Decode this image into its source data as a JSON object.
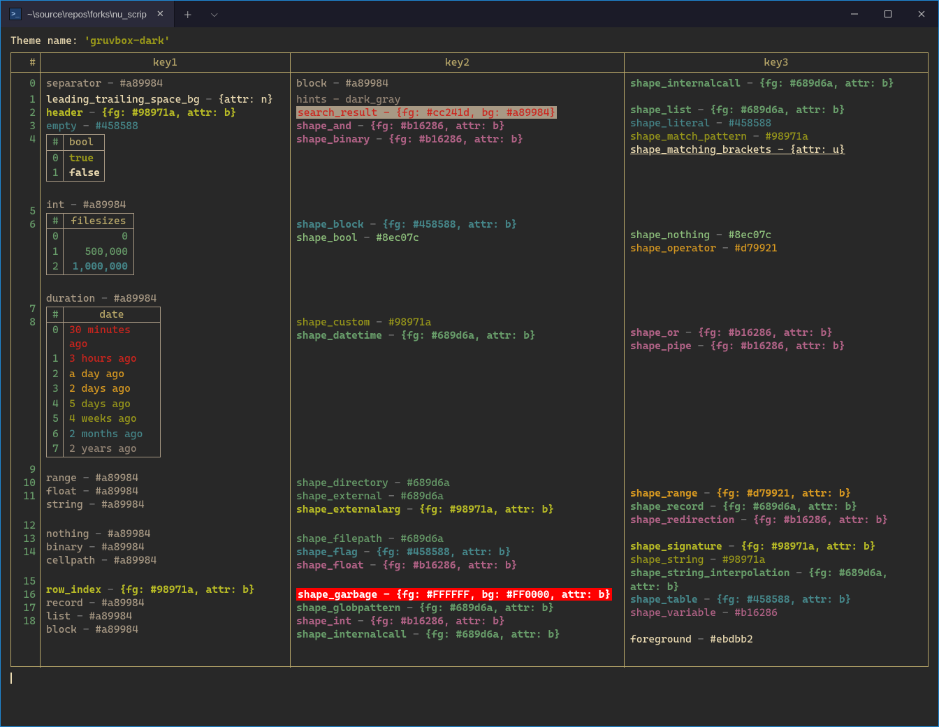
{
  "titlebar": {
    "tab_title": "~\\source\\repos\\forks\\nu_scrip",
    "tab_close": "✕",
    "newtab": "＋",
    "dropdown": "⌵"
  },
  "theme_label": "Theme name:",
  "theme_value": "'gruvbox-dark'",
  "columns": {
    "idx": "#",
    "k1": "key1",
    "k2": "key2",
    "k3": "key3"
  },
  "row_nums": [
    "0",
    "1",
    "2",
    "3",
    "4",
    "5",
    "6",
    "7",
    "8",
    "9",
    "10",
    "11",
    "12",
    "13",
    "14",
    "15",
    "16",
    "17",
    "18"
  ],
  "k1": {
    "separator": {
      "key": "separator",
      "sep": " - ",
      "val": "#a89984"
    },
    "leading": {
      "key": "leading_trailing_space_bg",
      "sep": " - ",
      "val": "{attr: n}"
    },
    "header": {
      "key": "header",
      "sep": " - ",
      "val": "{fg: #98971a, attr: b}"
    },
    "empty": {
      "key": "empty",
      "sep": " - ",
      "val": "#458588"
    },
    "int": {
      "key": "int",
      "sep": " - ",
      "val": "#a89984"
    },
    "duration": {
      "key": "duration",
      "sep": " - ",
      "val": "#a89984"
    },
    "range": {
      "key": "range",
      "sep": " - ",
      "val": "#a89984"
    },
    "float": {
      "key": "float",
      "sep": " - ",
      "val": "#a89984"
    },
    "string": {
      "key": "string",
      "sep": " - ",
      "val": "#a89984"
    },
    "nothing": {
      "key": "nothing",
      "sep": " - ",
      "val": "#a89984"
    },
    "binary": {
      "key": "binary",
      "sep": " - ",
      "val": "#a89984"
    },
    "cellpath": {
      "key": "cellpath",
      "sep": " - ",
      "val": "#a89984"
    },
    "row_index": {
      "key": "row_index",
      "sep": " - ",
      "val": "{fg: #98971a, attr: b}"
    },
    "record": {
      "key": "record",
      "sep": " - ",
      "val": "#a89984"
    },
    "list": {
      "key": "list",
      "sep": " - ",
      "val": "#a89984"
    },
    "block": {
      "key": "block",
      "sep": " - ",
      "val": "#a89984"
    }
  },
  "bool_tbl": {
    "hdr_i": "#",
    "hdr_v": "bool",
    "rows": [
      {
        "i": "0",
        "v": "true"
      },
      {
        "i": "1",
        "v": "false"
      }
    ]
  },
  "fs_tbl": {
    "hdr_i": "#",
    "hdr_v": "filesizes",
    "rows": [
      {
        "i": "0",
        "v": "0"
      },
      {
        "i": "1",
        "v": "500,000"
      },
      {
        "i": "2",
        "v": "1,000,000"
      }
    ]
  },
  "date_tbl": {
    "hdr_i": "#",
    "hdr_v": "date",
    "rows": [
      {
        "i": "0",
        "v": "30 minutes ago",
        "c": "red"
      },
      {
        "i": "1",
        "v": "3 hours ago",
        "c": "red"
      },
      {
        "i": "2",
        "v": "a day ago",
        "c": "orange"
      },
      {
        "i": "3",
        "v": "2 days ago",
        "c": "orange"
      },
      {
        "i": "4",
        "v": "5 days ago",
        "c": "green"
      },
      {
        "i": "5",
        "v": "4 weeks ago",
        "c": "green"
      },
      {
        "i": "6",
        "v": "2 months ago",
        "c": "cyan"
      },
      {
        "i": "7",
        "v": "2 years ago",
        "c": "gray"
      }
    ]
  },
  "k2": {
    "block": {
      "key": "block",
      "sep": " - ",
      "val": "#a89984"
    },
    "hints": {
      "key": "hints",
      "sep": " - ",
      "val": "dark_gray"
    },
    "search_result": {
      "txt": "search_result - {fg: #cc241d, bg: #a89984}"
    },
    "shape_and": {
      "key": "shape_and",
      "sep": " - ",
      "val": "{fg: #b16286, attr: b}"
    },
    "shape_binary": {
      "key": "shape_binary",
      "sep": " - ",
      "val": "{fg: #b16286, attr: b}"
    },
    "shape_block": {
      "key": "shape_block",
      "sep": " - ",
      "val": "{fg: #458588, attr: b}"
    },
    "shape_bool": {
      "key": "shape_bool",
      "sep": " - ",
      "val": "#8ec07c"
    },
    "shape_custom": {
      "key": "shape_custom",
      "sep": " - ",
      "val": "#98971a"
    },
    "shape_datetime": {
      "key": "shape_datetime",
      "sep": " - ",
      "val": "{fg: #689d6a, attr: b}"
    },
    "shape_directory": {
      "key": "shape_directory",
      "sep": " - ",
      "val": "#689d6a"
    },
    "shape_external": {
      "key": "shape_external",
      "sep": " - ",
      "val": "#689d6a"
    },
    "shape_externalarg": {
      "key": "shape_externalarg",
      "sep": " - ",
      "val": "{fg: #98971a, attr: b}"
    },
    "shape_filepath": {
      "key": "shape_filepath",
      "sep": " - ",
      "val": "#689d6a"
    },
    "shape_flag": {
      "key": "shape_flag",
      "sep": " - ",
      "val": "{fg: #458588, attr: b}"
    },
    "shape_float": {
      "key": "shape_float",
      "sep": " - ",
      "val": "{fg: #b16286, attr: b}"
    },
    "shape_garbage": {
      "txt": "shape_garbage - {fg: #FFFFFF, bg: #FF0000, attr: b}"
    },
    "shape_globpattern": {
      "key": "shape_globpattern",
      "sep": " - ",
      "val": "{fg: #689d6a, attr: b}"
    },
    "shape_int": {
      "key": "shape_int",
      "sep": " - ",
      "val": "{fg: #b16286, attr: b}"
    },
    "shape_internalcall": {
      "key": "shape_internalcall",
      "sep": " - ",
      "val": "{fg: #689d6a, attr: b}"
    }
  },
  "k3": {
    "shape_internalcall": {
      "key": "shape_internalcall",
      "sep": " - ",
      "val": "{fg: #689d6a, attr: b}"
    },
    "shape_list": {
      "key": "shape_list",
      "sep": " - ",
      "val": "{fg: #689d6a, attr: b}"
    },
    "shape_literal": {
      "key": "shape_literal",
      "sep": " - ",
      "val": "#458588"
    },
    "shape_match": {
      "key": "shape_match_pattern",
      "sep": " - ",
      "val": "#98971a"
    },
    "shape_matchbr": {
      "key": "shape_matching_brackets",
      "sep": " - ",
      "val": "{attr: u}"
    },
    "shape_nothing": {
      "key": "shape_nothing",
      "sep": " - ",
      "val": "#8ec07c"
    },
    "shape_operator": {
      "key": "shape_operator",
      "sep": " - ",
      "val": "#d79921"
    },
    "shape_or": {
      "key": "shape_or",
      "sep": " - ",
      "val": "{fg: #b16286, attr: b}"
    },
    "shape_pipe": {
      "key": "shape_pipe",
      "sep": " - ",
      "val": "{fg: #b16286, attr: b}"
    },
    "shape_range": {
      "key": "shape_range",
      "sep": " - ",
      "val": "{fg: #d79921, attr: b}"
    },
    "shape_record": {
      "key": "shape_record",
      "sep": " - ",
      "val": "{fg: #689d6a, attr: b}"
    },
    "shape_redirection": {
      "key": "shape_redirection",
      "sep": " - ",
      "val": "{fg: #b16286, attr: b}"
    },
    "shape_signature": {
      "key": "shape_signature",
      "sep": " - ",
      "val": "{fg: #98971a, attr: b}"
    },
    "shape_string": {
      "key": "shape_string",
      "sep": " - ",
      "val": "#98971a"
    },
    "shape_string_interp": {
      "key": "shape_string_interpolation",
      "sep": " - ",
      "val": "{fg: #689d6a, attr: b}"
    },
    "shape_table": {
      "key": "shape_table",
      "sep": " - ",
      "val": "{fg: #458588, attr: b}"
    },
    "shape_variable": {
      "key": "shape_variable",
      "sep": " - ",
      "val": "#b16286"
    },
    "foreground": {
      "key": "foreground",
      "sep": " - ",
      "val": "#ebdbb2"
    }
  }
}
